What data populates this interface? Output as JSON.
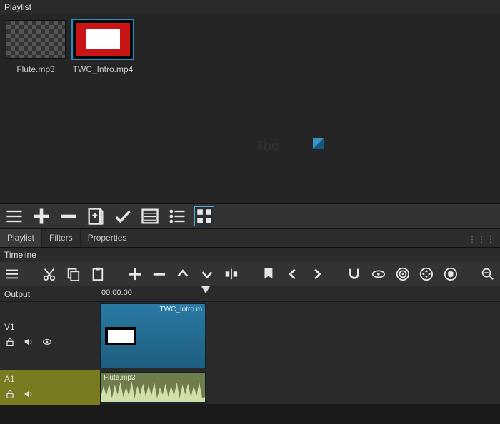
{
  "panels": {
    "playlist_title": "Playlist",
    "timeline_title": "Timeline"
  },
  "playlist": {
    "items": [
      {
        "label": "Flute.mp3",
        "icon": "audio-thumb",
        "selected": false
      },
      {
        "label": "TWC_Intro.mp4",
        "icon": "video-thumb",
        "selected": true
      }
    ]
  },
  "watermark": {
    "line1": "The",
    "line2": ""
  },
  "playlist_toolbar": {
    "menu": "menu-icon",
    "add": "add-icon",
    "remove": "remove-icon",
    "addfiles": "addfiles-icon",
    "check": "check-icon",
    "view_details": "details-icon",
    "view_list": "list-icon",
    "view_grid": "grid-icon",
    "view_selected": "grid"
  },
  "tabs": [
    {
      "label": "Playlist",
      "active": true
    },
    {
      "label": "Filters",
      "active": false
    },
    {
      "label": "Properties",
      "active": false
    }
  ],
  "timeline_toolbar": {
    "items": [
      "menu-icon",
      "cut-icon",
      "copy-icon",
      "paste-icon",
      "add-icon",
      "remove-icon",
      "up-icon",
      "down-icon",
      "split-icon",
      "marker-icon",
      "prev-icon",
      "next-icon",
      "snap-icon",
      "scrub-icon",
      "ripple-icon",
      "rippleall-icon",
      "shield-icon",
      "zoomout-icon"
    ]
  },
  "timeline": {
    "output_label": "Output",
    "tracks": [
      {
        "name": "V1",
        "type": "video",
        "icons": [
          "unlock-icon",
          "mute-icon",
          "eye-icon"
        ]
      },
      {
        "name": "A1",
        "type": "audio",
        "icons": [
          "unlock-icon",
          "mute-icon"
        ]
      }
    ],
    "ruler_start": "00:00:00",
    "clips": {
      "video": {
        "label": "TWC_Intro.m"
      },
      "audio": {
        "label": "Flute.mp3"
      }
    }
  }
}
